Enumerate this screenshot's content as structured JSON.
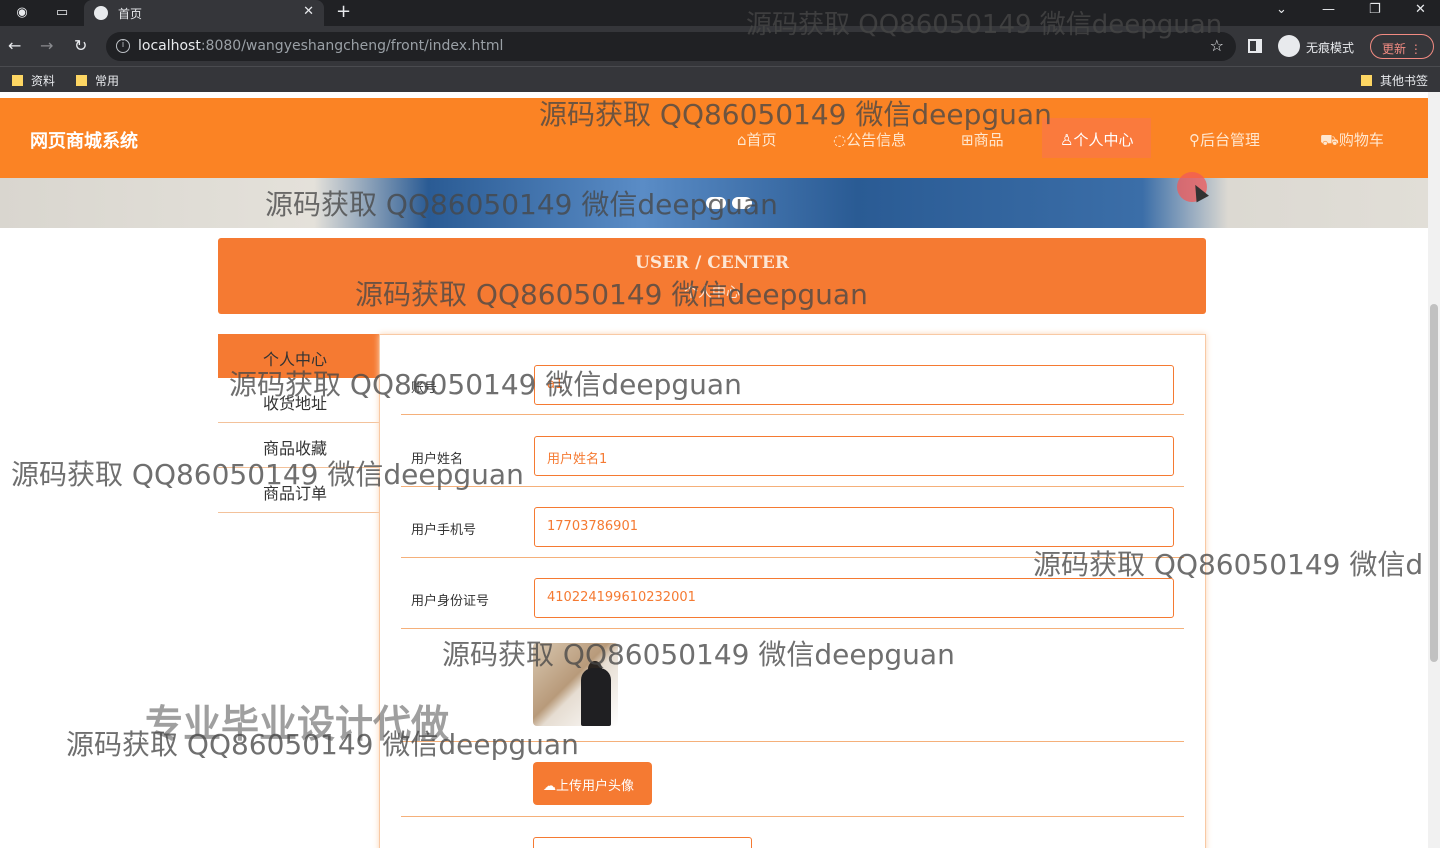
{
  "browser": {
    "tab_title": "首页",
    "url_host": "localhost",
    "url_rest": ":8080/wangyeshangcheng/front/index.html",
    "incognito_label": "无痕模式",
    "update_label": "更新",
    "bookmarks": [
      "资料",
      "常用"
    ],
    "other_bookmarks": "其他书签"
  },
  "site": {
    "brand": "网页商城系统",
    "nav": [
      {
        "icon": "home-icon",
        "label": "首页"
      },
      {
        "icon": "notice-icon",
        "label": "公告信息"
      },
      {
        "icon": "product-icon",
        "label": "商品"
      },
      {
        "icon": "user-icon",
        "label": "个人中心"
      },
      {
        "icon": "link-icon",
        "label": "后台管理"
      },
      {
        "icon": "cart-icon",
        "label": "购物车"
      }
    ],
    "active_nav": "个人中心"
  },
  "user_center": {
    "title": "USER / CENTER",
    "subtitle": "个人中心"
  },
  "sidebar": {
    "items": [
      {
        "label": "个人中心",
        "active": true
      },
      {
        "label": "收货地址"
      },
      {
        "label": "商品收藏"
      },
      {
        "label": "商品订单"
      }
    ]
  },
  "form": {
    "fields": [
      {
        "label": "账号",
        "value": "a1"
      },
      {
        "label": "用户姓名",
        "value": "用户姓名1"
      },
      {
        "label": "用户手机号",
        "value": "17703786901"
      },
      {
        "label": "用户身份证号",
        "value": "410224199610232001"
      }
    ],
    "upload_label": "上传用户头像"
  },
  "watermarks": [
    "源码获取 QQ86050149 微信deepguan",
    "源码获取 QQ86050149 微信d",
    "专业毕业设计代做"
  ],
  "colors": {
    "header": "#fb8324",
    "accent": "#f57a32",
    "active_nav": "#fa7a3d"
  }
}
